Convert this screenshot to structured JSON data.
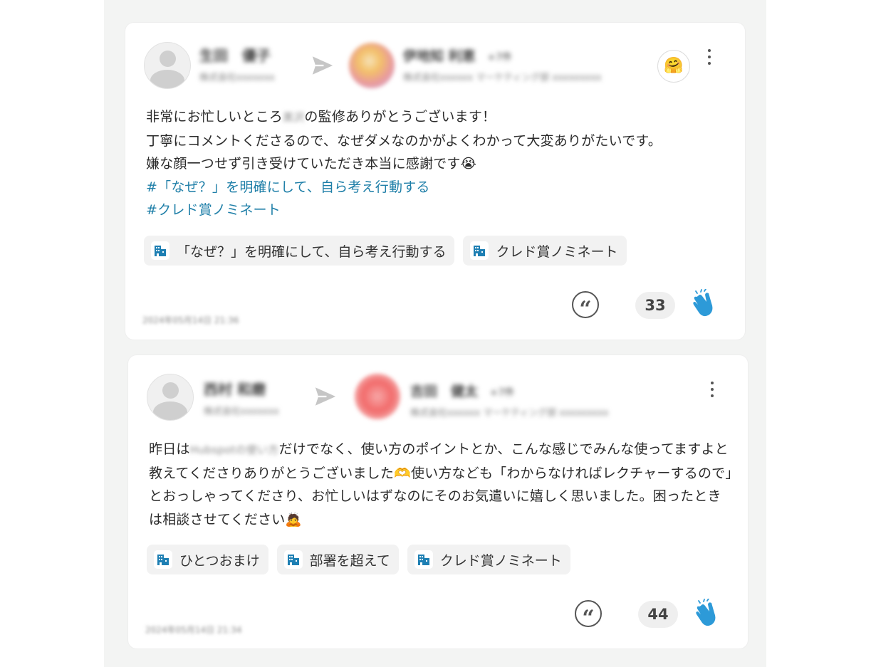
{
  "posts": [
    {
      "sender_name": "生田　優子",
      "sender_sub": "株式会社xxxxxxx",
      "recipient_name": "伊地知 利恵",
      "recipient_tag": "+7件",
      "recipient_sub": "株式会社xxxxxx マーケティング部 xxxxxxxxx",
      "emoji": "🤗",
      "lines": [
        {
          "before": "非常にお忙しいところ",
          "blur": "黒沢",
          "after": "の監修ありがとうございます！"
        },
        {
          "text": "丁寧にコメントくださるので、なぜダメなのかがよくわかって大変ありがたいです。"
        },
        {
          "text": "嫌な顔一つせず引き受けていただき本当に感謝です😭"
        }
      ],
      "hashtags": [
        "#「なぜ？」を明確にして、自ら考え行動する",
        "#クレド賞ノミネート"
      ],
      "tags": [
        "「なぜ？」を明確にして、自ら考え行動する",
        "クレド賞ノミネート"
      ],
      "applause_count": "33",
      "timestamp": "2024年05月14日 21:36"
    },
    {
      "sender_name": "西村 和磨",
      "sender_sub": "株式会社xxxxxxx",
      "recipient_name": "吉田　健太",
      "recipient_tag": "+7件",
      "recipient_sub": "株式会社xxxxxx マーケティング部 xxxxxxxxx",
      "text_before": "昨日は",
      "text_blur": "Hubspotの使い方",
      "text_after": "だけでなく、使い方のポイントとか、こんな感じでみんな使ってますよと教えてくださりありがとうございました🫶使い方なども「わからなければレクチャーするので」とおっしゃってくださり、お忙しいはずなのにそのお気遣いに嬉しく思いました。困ったときは相談させてください🙇",
      "tags": [
        "ひとつおまけ",
        "部署を超えて",
        "クレド賞ノミネート"
      ],
      "applause_count": "44",
      "timestamp": "2024年05月14日 21:34"
    }
  ],
  "colors": {
    "hashtag": "#1f7fa8",
    "building_icon": "#1e7fb3",
    "clap_icon": "#2d9ad8"
  },
  "icons": [
    "send-icon",
    "more-vert-icon",
    "quote-icon",
    "building-icon",
    "clap-icon"
  ]
}
